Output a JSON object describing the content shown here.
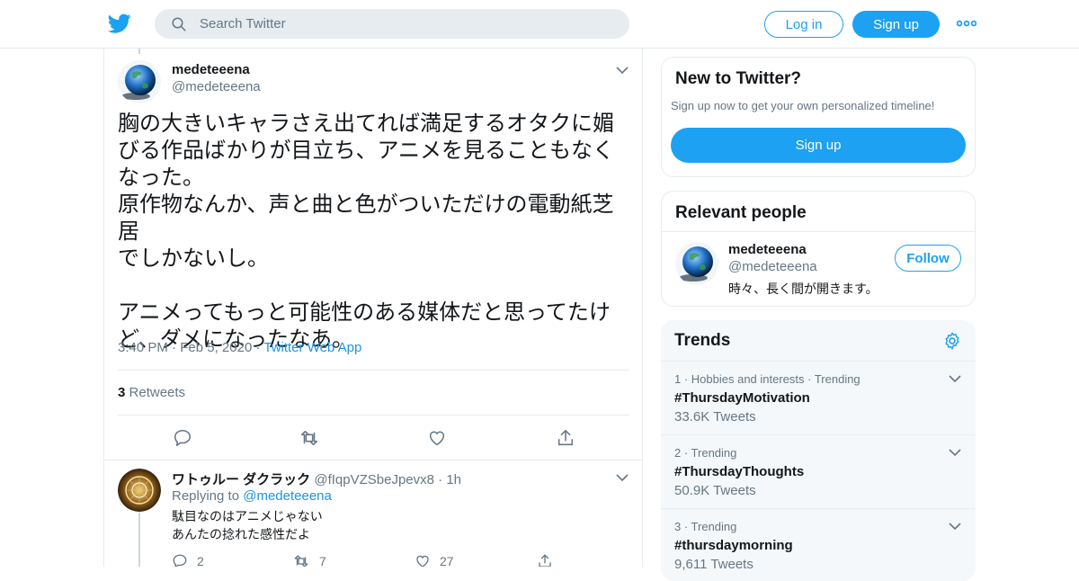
{
  "header": {
    "search_placeholder": "Search Twitter",
    "login_label": "Log in",
    "signup_label": "Sign up"
  },
  "tweet": {
    "author_name": "medeteeena",
    "author_handle": "@medeteeena",
    "text": "胸の大きいキャラさえ出てれば満足するオタクに媚\nびる作品ばかりが目立ち、アニメを見ることもなく\nなった。\n原作物なんか、声と曲と色がついただけの電動紙芝居\nでしかないし。\n\nアニメってもっと可能性のある媒体だと思ってたけ\nど、ダメになったなあ。",
    "time": "3:40 PM",
    "date": "Feb 5, 2020",
    "source": "Twitter Web App",
    "retweet_count": "3",
    "retweet_label": "Retweets"
  },
  "reply": {
    "author_name": "ワトゥルー ダクラック",
    "author_handle": "@fIqpVZSbeJpevx8",
    "time": "1h",
    "replying_prefix": "Replying to",
    "replying_to": "@medeteeena",
    "text": "駄目なのはアニメじゃない\nあんたの捻れた感性だよ",
    "reply_count": "2",
    "retweet_count": "7",
    "like_count": "27"
  },
  "sidebar": {
    "new_title": "New to Twitter?",
    "new_subtitle": "Sign up now to get your own personalized timeline!",
    "signup_label": "Sign up",
    "relevant_title": "Relevant people",
    "person": {
      "name": "medeteeena",
      "handle": "@medeteeena",
      "bio": "時々、長く間が開きます。",
      "follow_label": "Follow"
    },
    "trends_title": "Trends",
    "trends": [
      {
        "meta": "1 · Hobbies and interests · Trending",
        "tag": "#ThursdayMotivation",
        "count": "33.6K Tweets"
      },
      {
        "meta": "2 · Trending",
        "tag": "#ThursdayThoughts",
        "count": "50.9K Tweets"
      },
      {
        "meta": "3 · Trending",
        "tag": "#thursdaymorning",
        "count": "9,611 Tweets"
      }
    ]
  },
  "colors": {
    "accent": "#1da1f2",
    "link": "#1b95e0",
    "secondary_text": "#657786"
  }
}
